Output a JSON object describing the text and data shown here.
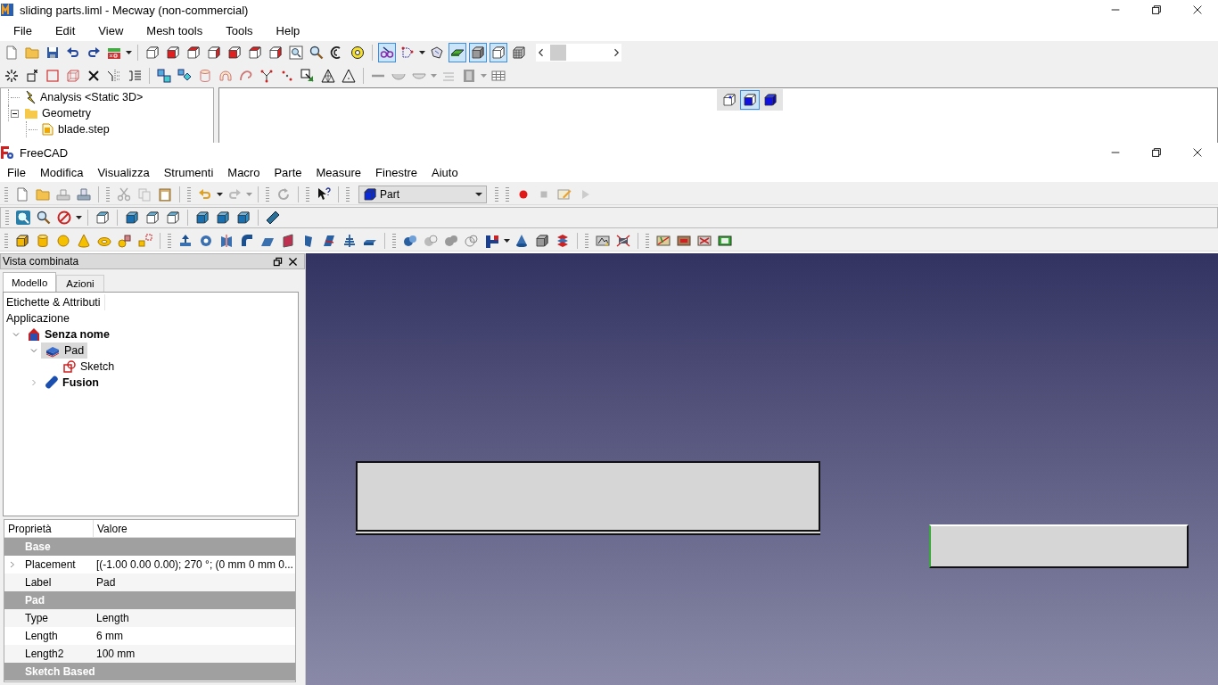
{
  "mecway": {
    "title": "sliding parts.liml - Mecway (non-commercial)",
    "menu": [
      "File",
      "Edit",
      "View",
      "Mesh tools",
      "Tools",
      "Help"
    ],
    "tree": [
      {
        "label": "Analysis <Static 3D>",
        "kind": "analysis"
      },
      {
        "label": "Geometry",
        "kind": "folder",
        "expanded": true,
        "children": [
          {
            "label": "blade.step",
            "kind": "geometry"
          }
        ]
      }
    ],
    "view_modes": [
      {
        "kind": "wireframe",
        "selected": false
      },
      {
        "kind": "solid-edges",
        "selected": true
      },
      {
        "kind": "solid",
        "selected": false
      }
    ]
  },
  "freecad": {
    "title": "FreeCAD",
    "menu": [
      "File",
      "Modifica",
      "Visualizza",
      "Strumenti",
      "Macro",
      "Parte",
      "Measure",
      "Finestre",
      "Aiuto"
    ],
    "workbench": "Part",
    "panel_title": "Vista combinata",
    "tabs": [
      {
        "label": "Modello",
        "selected": true
      },
      {
        "label": "Azioni",
        "selected": false
      }
    ],
    "tree_header": "Etichette & Attributi",
    "tree_root": "Applicazione",
    "tree": [
      {
        "label": "Senza nome",
        "kind": "document",
        "bold": true,
        "selected": false,
        "expanded": true,
        "children": [
          {
            "label": "Pad",
            "kind": "pad",
            "bold": false,
            "selected": true,
            "expanded": true,
            "children": [
              {
                "label": "Sketch",
                "kind": "sketch",
                "bold": false,
                "selected": false
              }
            ]
          },
          {
            "label": "Fusion",
            "kind": "fusion",
            "bold": true,
            "selected": false,
            "expanded": false
          }
        ]
      }
    ],
    "properties": {
      "columns": [
        "Proprietà",
        "Valore"
      ],
      "rows": [
        {
          "kind": "group",
          "label": "Base"
        },
        {
          "kind": "property",
          "name": "Placement",
          "value": "[(-1.00 0.00 0.00); 270 °; (0 mm  0 mm  0...",
          "expandable": true
        },
        {
          "kind": "property",
          "name": "Label",
          "value": "Pad",
          "expandable": false
        },
        {
          "kind": "group",
          "label": "Pad"
        },
        {
          "kind": "property",
          "name": "Type",
          "value": "Length",
          "expandable": false
        },
        {
          "kind": "property",
          "name": "Length",
          "value": "6 mm",
          "expandable": false
        },
        {
          "kind": "property",
          "name": "Length2",
          "value": "100 mm",
          "expandable": false
        },
        {
          "kind": "group",
          "label": "Sketch Based"
        }
      ]
    }
  }
}
